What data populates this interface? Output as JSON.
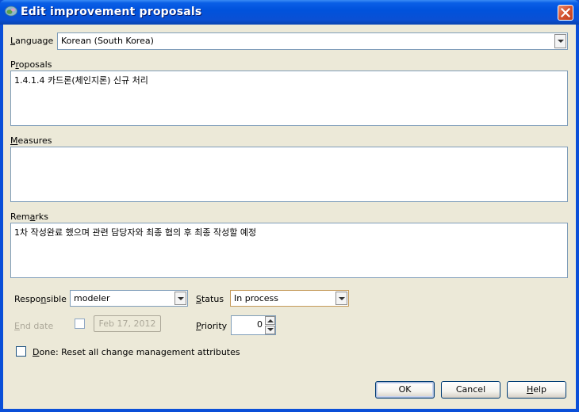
{
  "window": {
    "title": "Edit improvement proposals",
    "title_icon": "app-icon",
    "close_icon": "close-icon"
  },
  "language": {
    "label": "Language",
    "mnemonic": "L",
    "value": "Korean (South Korea)"
  },
  "proposals": {
    "label": "Proposals",
    "value": "1.4.1.4 카드론(체인지론) 신규 처리"
  },
  "measures": {
    "label": "Measures",
    "value": ""
  },
  "remarks": {
    "label": "Remarks",
    "value": "1차 작성완료 했으며 관련 담당자와 최종 협의 후 최종 작성할 예정"
  },
  "responsible": {
    "label": "Responsible",
    "value": "modeler"
  },
  "status": {
    "label": "Status",
    "value": "In process"
  },
  "end_date": {
    "label": "End date",
    "checked": false,
    "value": "Feb 17, 2012"
  },
  "priority": {
    "label": "Priority",
    "value": "0"
  },
  "done": {
    "label": "Done: Reset all change management attributes",
    "checked": false
  },
  "buttons": {
    "ok": "OK",
    "cancel": "Cancel",
    "help": "Help"
  }
}
